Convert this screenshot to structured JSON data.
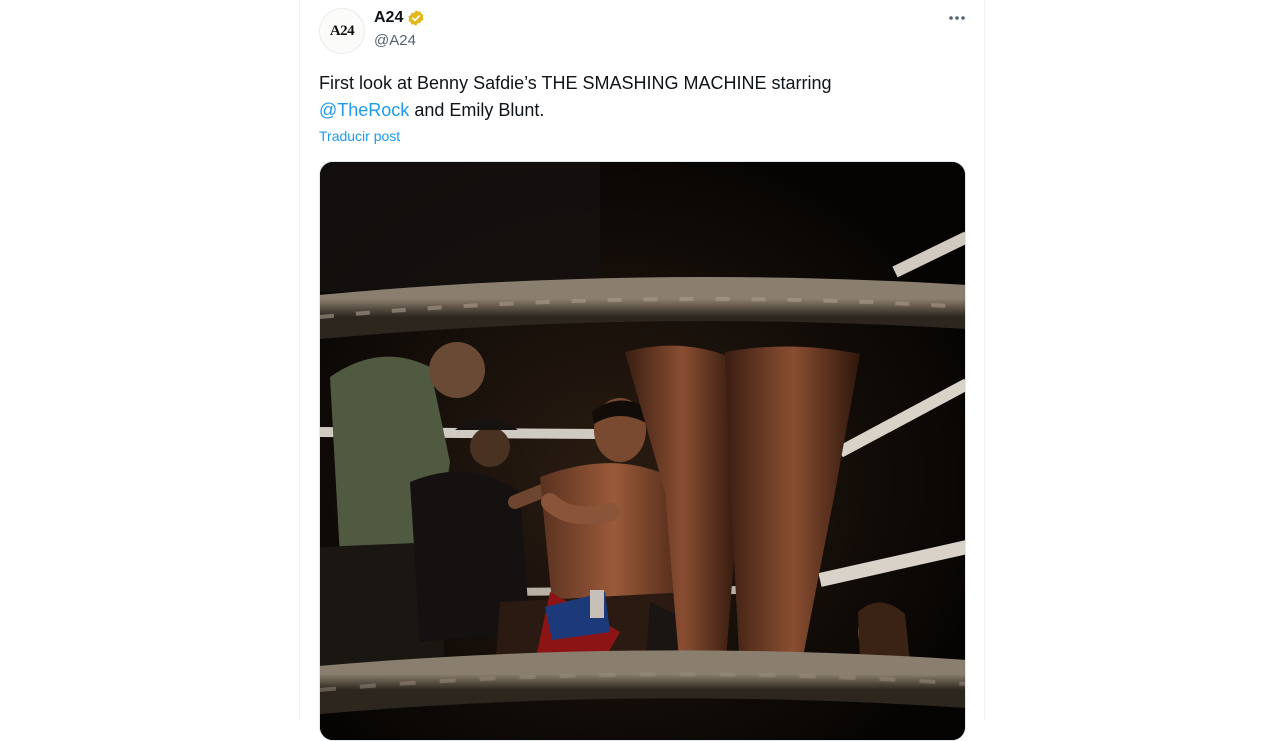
{
  "post": {
    "author": {
      "name": "A24",
      "handle": "@A24",
      "avatar_text": "A24",
      "verified_badge": "gold-verified-badge-icon"
    },
    "more_icon": "more-options-icon",
    "text_before": "First look at Benny Safdie’s THE SMASHING MACHINE starring",
    "mention": "@TheRock",
    "text_after": " and Emily Blunt.",
    "translate_label": "Traducir post"
  },
  "colors": {
    "link": "#1d9bf0",
    "text": "#0f1419",
    "secondary": "#536471",
    "verified_gold": "#e2b719"
  }
}
